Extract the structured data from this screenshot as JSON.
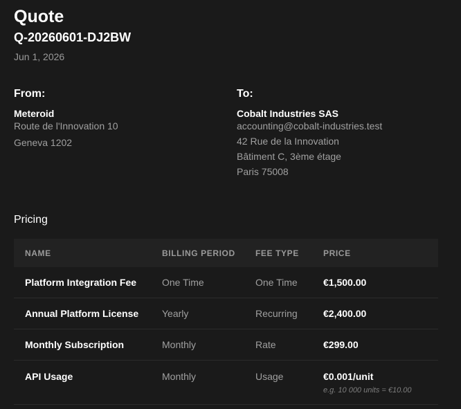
{
  "document": {
    "title": "Quote",
    "number": "Q-20260601-DJ2BW",
    "date": "Jun 1, 2026"
  },
  "from": {
    "heading": "From:",
    "name": "Meteroid",
    "lines": [
      "Route de l'Innovation 10",
      "Geneva 1202"
    ]
  },
  "to": {
    "heading": "To:",
    "name": "Cobalt Industries SAS",
    "lines": [
      "accounting@cobalt-industries.test",
      "42 Rue de la Innovation",
      "Bâtiment C, 3ème étage",
      "Paris 75008"
    ]
  },
  "pricing": {
    "title": "Pricing",
    "columns": [
      "Name",
      "Billing Period",
      "Fee Type",
      "Price"
    ],
    "rows": [
      {
        "name": "Platform Integration Fee",
        "billing_period": "One Time",
        "fee_type": "One Time",
        "price": "€1,500.00",
        "example": ""
      },
      {
        "name": "Annual Platform License",
        "billing_period": "Yearly",
        "fee_type": "Recurring",
        "price": "€2,400.00",
        "example": ""
      },
      {
        "name": "Monthly Subscription",
        "billing_period": "Monthly",
        "fee_type": "Rate",
        "price": "€299.00",
        "example": ""
      },
      {
        "name": "API Usage",
        "billing_period": "Monthly",
        "fee_type": "Usage",
        "price": "€0.001/unit",
        "example": "e.g. 10 000 units = €10.00"
      }
    ]
  },
  "colors": {
    "background": "#1a1a1a",
    "table_header": "#222222",
    "text_primary": "#ffffff",
    "text_secondary": "#a0a0a0"
  }
}
